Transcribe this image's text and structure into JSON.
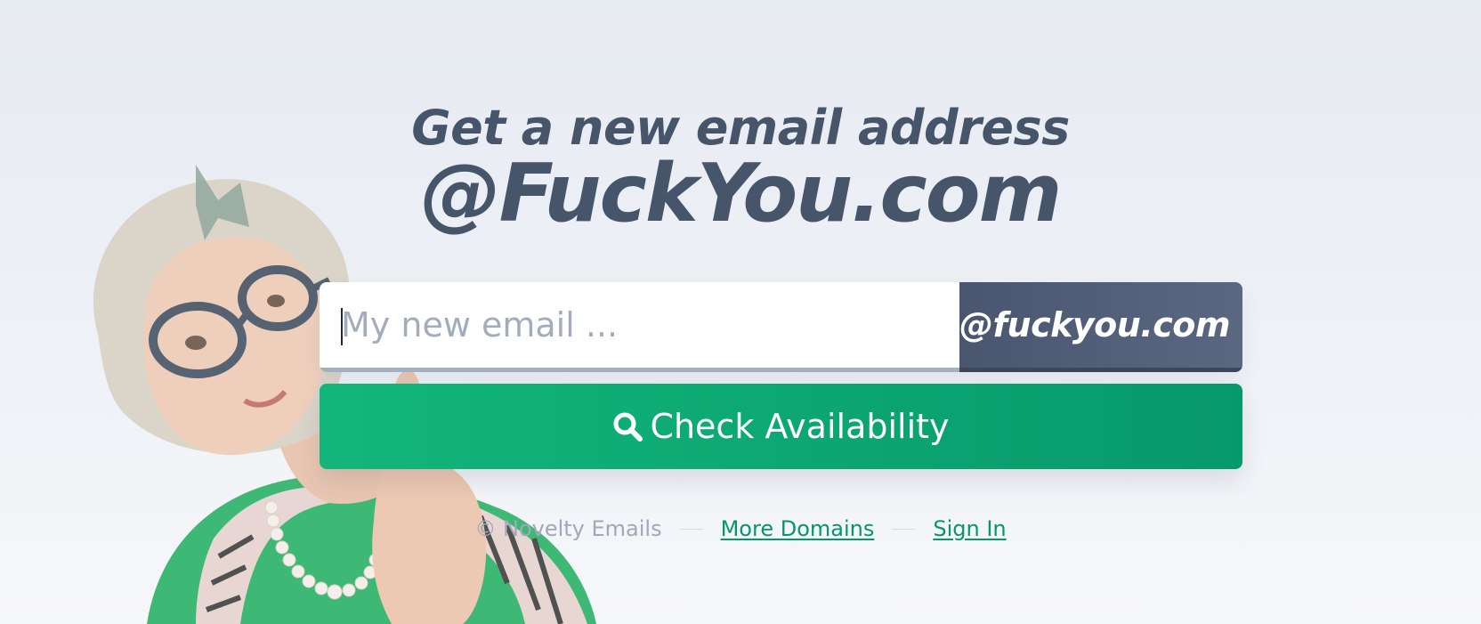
{
  "hero": {
    "title_line1": "Get a new email address",
    "title_line2": "@FuckYou.com"
  },
  "form": {
    "email_placeholder": "My new email ...",
    "email_value": "",
    "domain_suffix": "@fuckyou.com",
    "submit_label": "Check Availability",
    "submit_icon": "search-icon"
  },
  "footer": {
    "copyright": "© Novelty Emails",
    "links": [
      {
        "label": "More Domains"
      },
      {
        "label": "Sign In"
      }
    ]
  },
  "colors": {
    "heading": "#465569",
    "accent_green": "#07996a",
    "addon_slate": "#4a5670",
    "link": "#07966a",
    "muted": "#a0a9b8"
  }
}
